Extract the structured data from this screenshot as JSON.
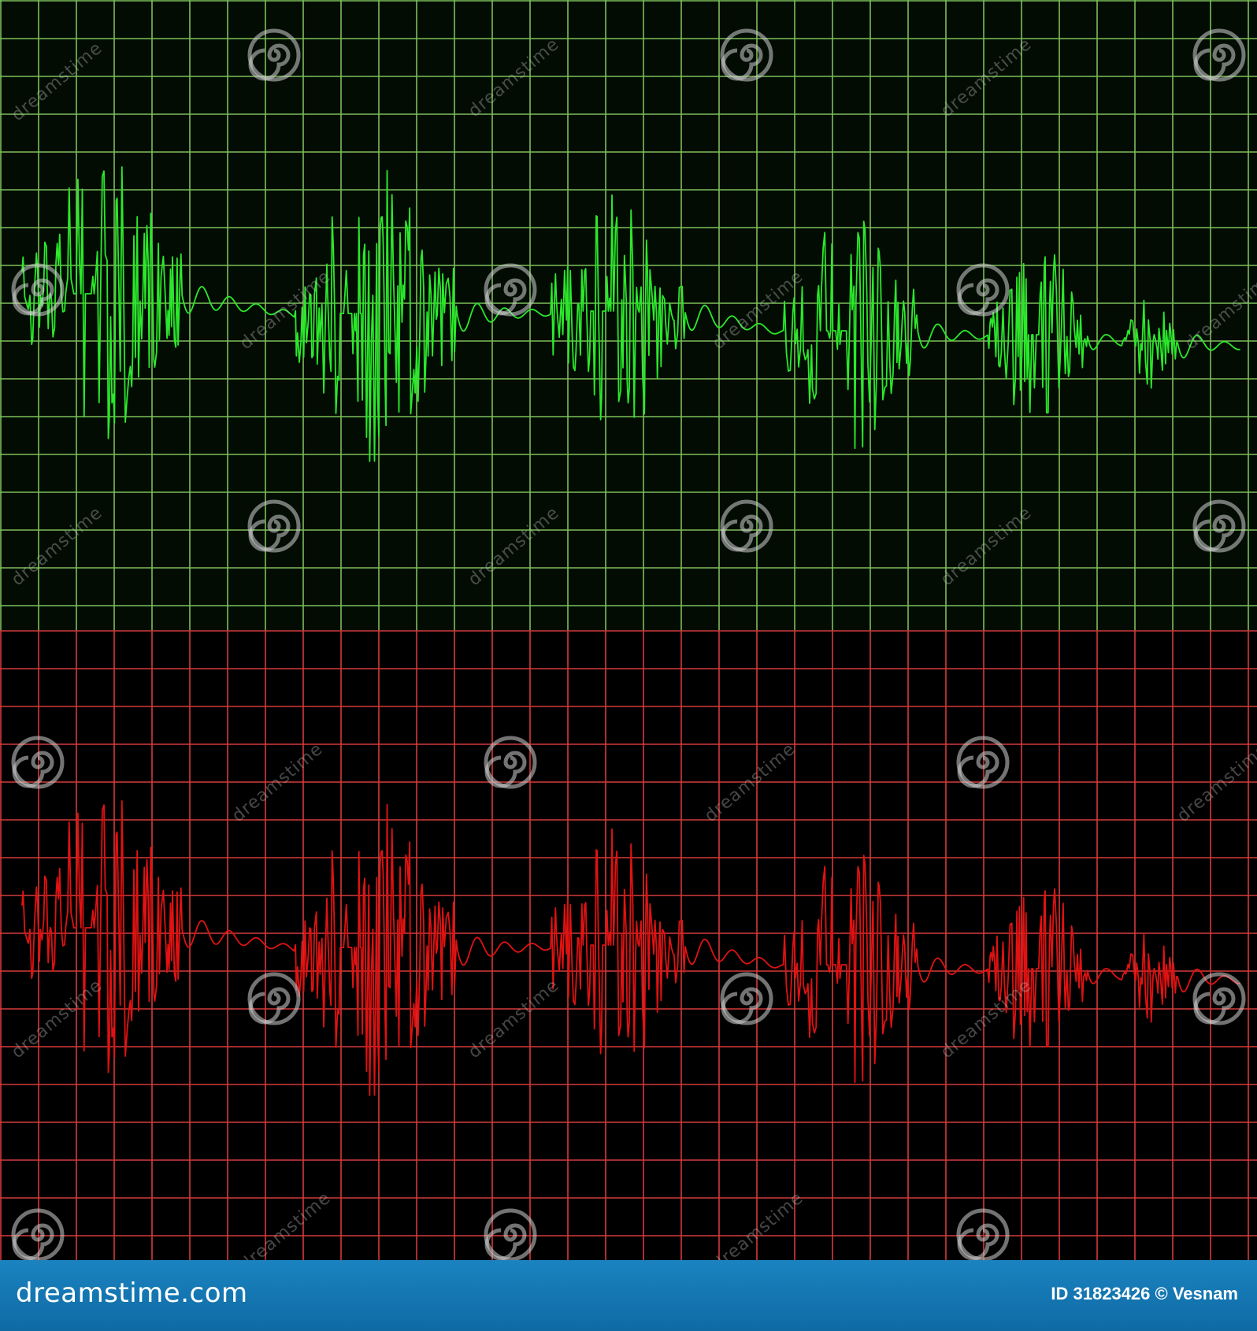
{
  "colors": {
    "green_panel_bg": "#020c03",
    "green_grid": "#7cbe5a",
    "green_wave": "#2be82b",
    "red_panel_bg": "#000000",
    "red_grid": "#d63a3a",
    "red_wave": "#e01212",
    "footer_bg": "#1479b7"
  },
  "watermark": {
    "text": "dreamstime",
    "icon": "spiral-icon"
  },
  "footer": {
    "brand": "dreamstime.com",
    "credit": "ID 31823426 © Vesnam"
  }
}
